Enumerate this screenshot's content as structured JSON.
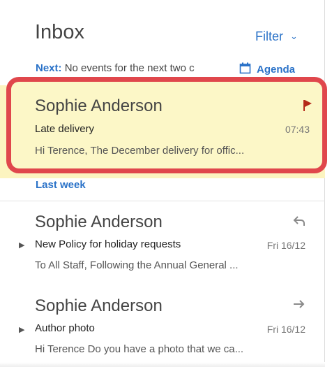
{
  "header": {
    "title": "Inbox",
    "filter_label": "Filter"
  },
  "agenda": {
    "next_label": "Next:",
    "next_text": "No events for the next two c",
    "agenda_label": "Agenda"
  },
  "section": {
    "last_week": "Last week"
  },
  "messages": [
    {
      "sender": "Sophie Anderson",
      "subject": "Late delivery",
      "preview": "Hi Terence,   The December delivery for offic...",
      "time": "07:43",
      "status_icon": "flag-icon",
      "flag_color": "#b52a1a",
      "selected": true
    },
    {
      "sender": "Sophie Anderson",
      "subject": "New Policy for holiday requests",
      "preview": "To All Staff,  Following the Annual General ...",
      "time": "Fri 16/12",
      "status_icon": "reply-icon",
      "selected": false
    },
    {
      "sender": "Sophie Anderson",
      "subject": "Author photo",
      "preview": "Hi Terence   Do you have a photo that we ca...",
      "time": "Fri 16/12",
      "status_icon": "forward-icon",
      "selected": false
    }
  ],
  "colors": {
    "accent": "#2a72c8",
    "highlight_border": "#e0474c",
    "selected_background": "#fcf4c0"
  }
}
